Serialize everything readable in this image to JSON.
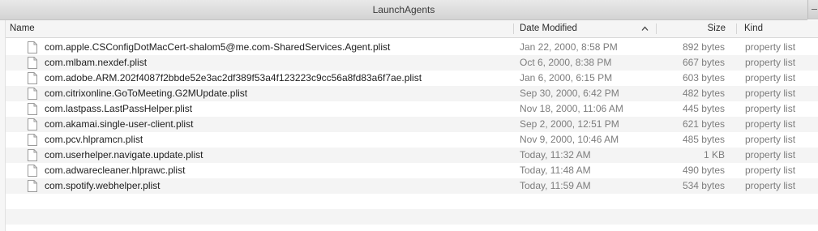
{
  "window": {
    "title": "LaunchAgents"
  },
  "columns": {
    "name": "Name",
    "date_modified": "Date Modified",
    "size": "Size",
    "kind": "Kind",
    "sort_indicator": "^"
  },
  "files": [
    {
      "name": "com.apple.CSConfigDotMacCert-shalom5@me.com-SharedServices.Agent.plist",
      "date": "Jan 22, 2000, 8:58 PM",
      "size": "892 bytes",
      "kind": "property list",
      "icon": "document-icon"
    },
    {
      "name": "com.mlbam.nexdef.plist",
      "date": "Oct 6, 2000, 8:38 PM",
      "size": "667 bytes",
      "kind": "property list",
      "icon": "document-icon"
    },
    {
      "name": "com.adobe.ARM.202f4087f2bbde52e3ac2df389f53a4f123223c9cc56a8fd83a6f7ae.plist",
      "date": "Jan 6, 2000, 6:15 PM",
      "size": "603 bytes",
      "kind": "property list",
      "icon": "document-icon"
    },
    {
      "name": "com.citrixonline.GoToMeeting.G2MUpdate.plist",
      "date": "Sep 30, 2000, 6:42 PM",
      "size": "482 bytes",
      "kind": "property list",
      "icon": "document-icon"
    },
    {
      "name": "com.lastpass.LastPassHelper.plist",
      "date": "Nov 18, 2000, 11:06 AM",
      "size": "445 bytes",
      "kind": "property list",
      "icon": "document-icon"
    },
    {
      "name": "com.akamai.single-user-client.plist",
      "date": "Sep 2, 2000, 12:51 PM",
      "size": "621 bytes",
      "kind": "property list",
      "icon": "document-icon"
    },
    {
      "name": "com.pcv.hlpramcn.plist",
      "date": "Nov 9, 2000, 10:46 AM",
      "size": "485 bytes",
      "kind": "property list",
      "icon": "document-icon"
    },
    {
      "name": "com.userhelper.navigate.update.plist",
      "date": "Today, 11:32 AM",
      "size": "1 KB",
      "kind": "property list",
      "icon": "document-icon"
    },
    {
      "name": "com.adwarecleaner.hlprawc.plist",
      "date": "Today, 11:48 AM",
      "size": "490 bytes",
      "kind": "property list",
      "icon": "document-icon"
    },
    {
      "name": "com.spotify.webhelper.plist",
      "date": "Today, 11:59 AM",
      "size": "534 bytes",
      "kind": "property list",
      "icon": "document-icon"
    }
  ],
  "colors": {
    "row_alt": "#f4f4f4",
    "secondary_text": "#7d7d7d",
    "header_bg": "#f5f5f5"
  }
}
